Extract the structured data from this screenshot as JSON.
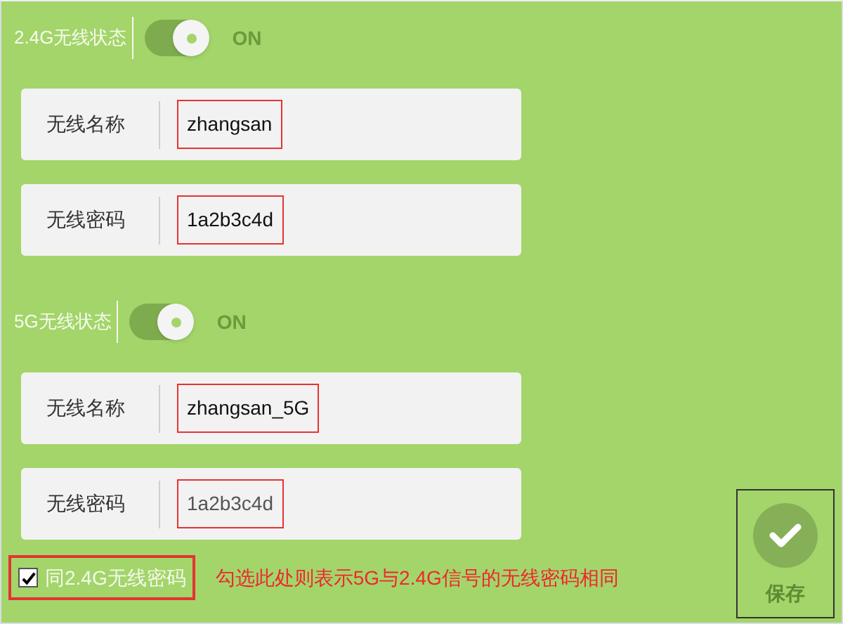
{
  "sections": [
    {
      "status_label": "2.4G无线状态",
      "toggle": {
        "on": true,
        "label": "ON"
      },
      "fields": [
        {
          "label": "无线名称",
          "value": "zhangsan",
          "disabled": false
        },
        {
          "label": "无线密码",
          "value": "1a2b3c4d",
          "disabled": false
        }
      ]
    },
    {
      "status_label": "5G无线状态",
      "toggle": {
        "on": true,
        "label": "ON"
      },
      "fields": [
        {
          "label": "无线名称",
          "value": "zhangsan_5G",
          "disabled": false
        },
        {
          "label": "无线密码",
          "value": "1a2b3c4d",
          "disabled": true
        }
      ]
    }
  ],
  "same_password": {
    "label": "同2.4G无线密码",
    "checked": true
  },
  "annotation": "勾选此处则表示5G与2.4G信号的无线密码相同",
  "save_button": {
    "label": "保存"
  }
}
